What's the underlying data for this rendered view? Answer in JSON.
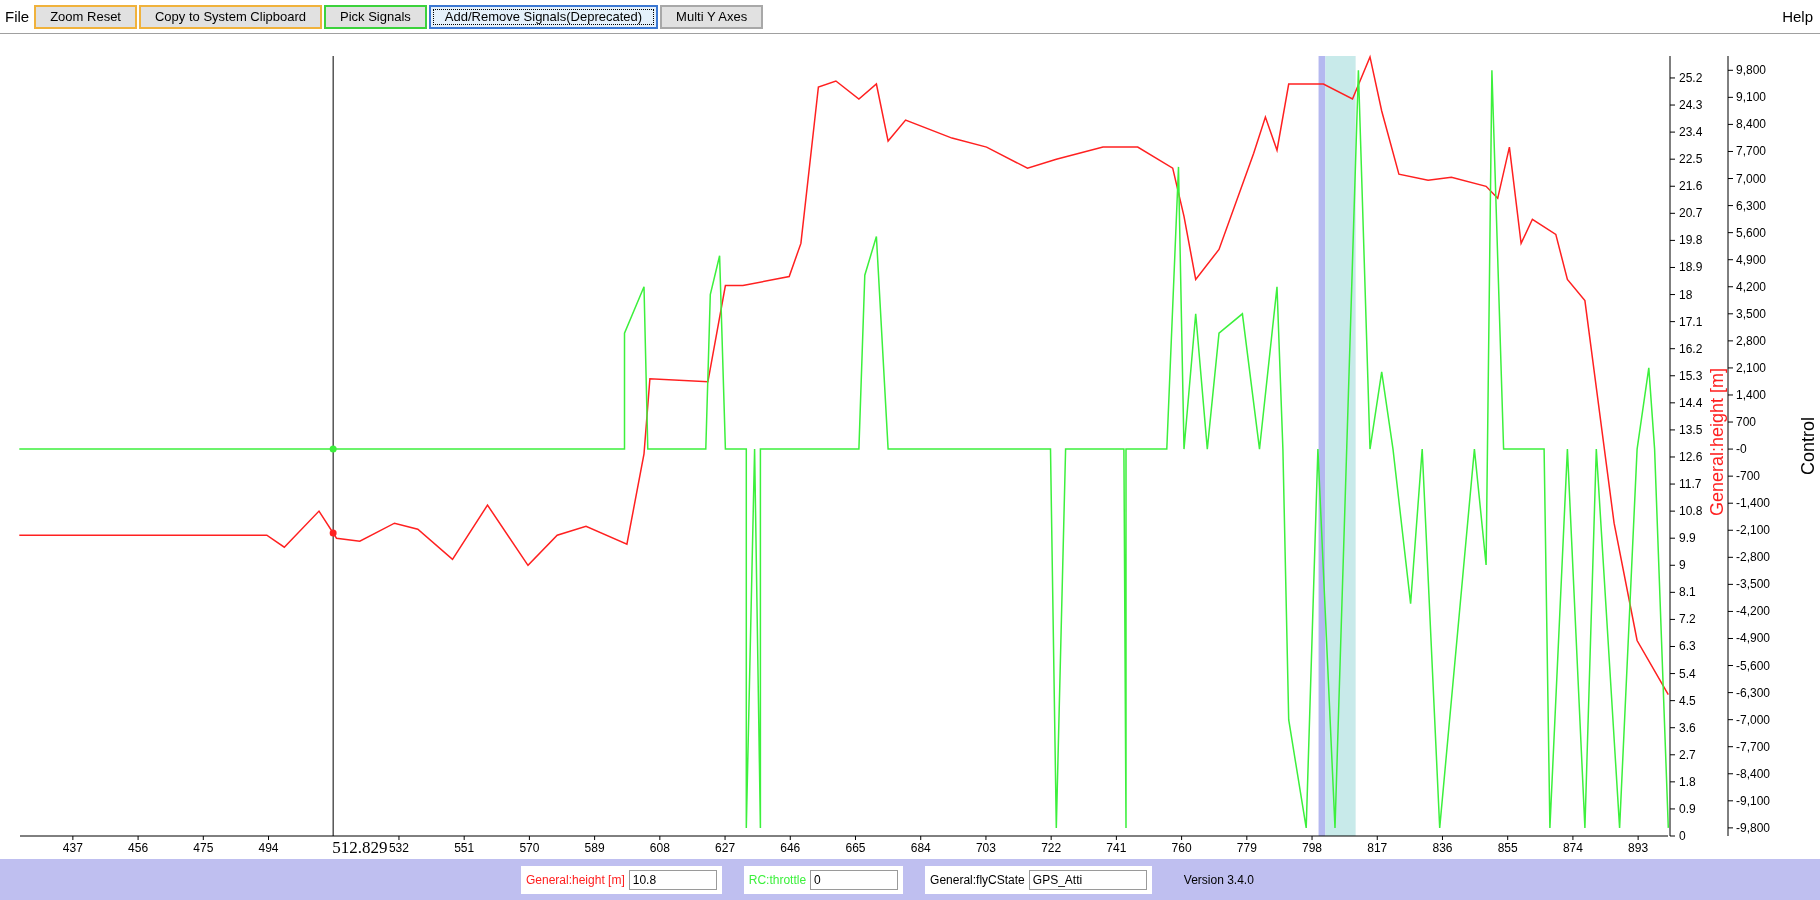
{
  "menu": {
    "file": "File",
    "help": "Help"
  },
  "toolbar": [
    {
      "label": "Zoom Reset",
      "color": "#f0b23c",
      "focused": false
    },
    {
      "label": "Copy to System Clipboard",
      "color": "#f0b23c",
      "focused": false
    },
    {
      "label": "Pick Signals",
      "color": "#3cd23c",
      "focused": false
    },
    {
      "label": "Add/Remove Signals(Deprecated)",
      "color": "#3c78d2",
      "focused": true
    },
    {
      "label": "Multi Y Axes",
      "color": "#a8a8a8",
      "focused": false
    }
  ],
  "chart_data": {
    "type": "line",
    "ylabel": "General:height [m]",
    "y2label": "Control",
    "xlim": [
      421.4,
      901.8
    ],
    "ylim": [
      0,
      25.93
    ],
    "y2lim": [
      -10010,
      10170
    ],
    "xticks": [
      437,
      456,
      475,
      494,
      532,
      551,
      570,
      589,
      608,
      627,
      646,
      665,
      684,
      703,
      722,
      741,
      760,
      779,
      798,
      817,
      836,
      855,
      874,
      893
    ],
    "yticks": [
      0,
      0.9,
      1.8,
      2.7,
      3.6,
      4.5,
      5.4,
      6.3,
      7.2,
      8.1,
      9,
      9.9,
      10.8,
      11.7,
      12.6,
      13.5,
      14.4,
      15.3,
      16.2,
      17.1,
      18,
      18.9,
      19.8,
      20.7,
      21.6,
      22.5,
      23.4,
      24.3,
      25.2
    ],
    "y2ticks": [
      {
        "value": -9800,
        "label": "-9,800"
      },
      {
        "value": -9100,
        "label": "-9,100"
      },
      {
        "value": -8400,
        "label": "-8,400"
      },
      {
        "value": -7700,
        "label": "-7,700"
      },
      {
        "value": -7000,
        "label": "-7,000"
      },
      {
        "value": -6300,
        "label": "-6,300"
      },
      {
        "value": -5600,
        "label": "-5,600"
      },
      {
        "value": -4900,
        "label": "-4,900"
      },
      {
        "value": -4200,
        "label": "-4,200"
      },
      {
        "value": -3500,
        "label": "-3,500"
      },
      {
        "value": -2800,
        "label": "-2,800"
      },
      {
        "value": -2100,
        "label": "-2,100"
      },
      {
        "value": -1400,
        "label": "-1,400"
      },
      {
        "value": -700,
        "label": "-700"
      },
      {
        "value": 0,
        "label": "-0"
      },
      {
        "value": 700,
        "label": "700"
      },
      {
        "value": 1400,
        "label": "1,400"
      },
      {
        "value": 2100,
        "label": "2,100"
      },
      {
        "value": 2800,
        "label": "2,800"
      },
      {
        "value": 3500,
        "label": "3,500"
      },
      {
        "value": 4200,
        "label": "4,200"
      },
      {
        "value": 4900,
        "label": "4,900"
      },
      {
        "value": 5600,
        "label": "5,600"
      },
      {
        "value": 6300,
        "label": "6,300"
      },
      {
        "value": 7000,
        "label": "7,000"
      },
      {
        "value": 7700,
        "label": "7,700"
      },
      {
        "value": 8400,
        "label": "8,400"
      },
      {
        "value": 9100,
        "label": "9,100"
      },
      {
        "value": 9800,
        "label": "9,800"
      }
    ],
    "series": [
      {
        "name": "General:height [m]",
        "color": "#ff2020",
        "x": [
          421.4,
          493.5,
          498.6,
          508.7,
          513.8,
          520.6,
          530.7,
          537.5,
          547.6,
          557.8,
          569.6,
          578.1,
          586.5,
          598.4,
          603.4,
          605.1,
          622.0,
          627.1,
          632.2,
          645.7,
          649.1,
          654.2,
          659.3,
          666.0,
          671.1,
          674.5,
          679.6,
          693.1,
          703.2,
          715.1,
          723.5,
          737.1,
          747.2,
          757.4,
          760.7,
          764.1,
          770.9,
          781.0,
          784.4,
          787.8,
          791.2,
          801.3,
          809.8,
          814.9,
          818.3,
          823.3,
          831.8,
          838.6,
          848.7,
          852.1,
          855.5,
          858.9,
          862.2,
          869.0,
          872.4,
          877.5,
          886.0,
          892.7,
          901.8
        ],
        "values": [
          10.0,
          10.0,
          9.6,
          10.8,
          9.9,
          9.8,
          10.4,
          10.2,
          9.2,
          11.0,
          9.0,
          10.0,
          10.3,
          9.7,
          12.7,
          15.2,
          15.1,
          18.3,
          18.3,
          18.6,
          19.7,
          24.9,
          25.1,
          24.5,
          25.0,
          23.1,
          23.8,
          23.2,
          22.9,
          22.2,
          22.5,
          22.9,
          22.9,
          22.2,
          20.6,
          18.5,
          19.5,
          22.7,
          23.9,
          22.8,
          25.0,
          25.0,
          24.5,
          25.9,
          24.1,
          22.0,
          21.8,
          21.9,
          21.6,
          21.2,
          22.9,
          19.7,
          20.5,
          20.0,
          18.5,
          17.8,
          10.4,
          6.5,
          4.7
        ]
      },
      {
        "name": "RC:throttle",
        "color": "#3cf03c",
        "axis": "y2",
        "x": [
          421.4,
          597.7,
          597.7,
          603.4,
          604.5,
          621.4,
          622.7,
          625.4,
          627.1,
          633.2,
          633.2,
          635.6,
          637.3,
          637.3,
          666.0,
          667.7,
          671.1,
          674.5,
          721.8,
          723.5,
          726.2,
          743.2,
          743.8,
          743.8,
          755.7,
          759.1,
          760.7,
          764.1,
          767.5,
          770.9,
          777.7,
          782.7,
          787.8,
          789.5,
          791.2,
          796.3,
          799.7,
          804.7,
          811.5,
          814.9,
          818.3,
          821.6,
          826.7,
          830.1,
          835.2,
          845.3,
          848.7,
          850.4,
          853.8,
          865.6,
          867.3,
          872.4,
          877.5,
          880.8,
          887.6,
          892.7,
          896.1,
          897.8,
          901.8
        ],
        "values": [
          0,
          0,
          3000,
          4200,
          0,
          0,
          4000,
          5000,
          0,
          0,
          -9800,
          0,
          -9800,
          0,
          0,
          4500,
          5500,
          0,
          0,
          -9800,
          0,
          0,
          -9800,
          0,
          0,
          7300,
          0,
          3500,
          0,
          3000,
          3500,
          0,
          4200,
          0,
          -7000,
          -9800,
          0,
          -9800,
          9800,
          0,
          2000,
          0,
          -4000,
          0,
          -9800,
          0,
          -3000,
          9800,
          0,
          0,
          -9800,
          0,
          -9800,
          0,
          -9800,
          0,
          2100,
          0,
          -9800
        ]
      }
    ],
    "ref_lines": [
      {
        "axis": "x",
        "value": 512.829,
        "label": "512.829"
      }
    ],
    "bands": [
      {
        "axis": "x",
        "from": 799.9,
        "to": 801.9,
        "color": "#b4b8f0"
      },
      {
        "axis": "x",
        "from": 801.9,
        "to": 810.7,
        "color": "#c8eaea"
      }
    ]
  },
  "status_bar": {
    "fields": [
      {
        "value": "10.8"
      },
      {
        "value": "0"
      },
      {
        "label": "General:flyCState",
        "value": "GPS_Atti"
      }
    ],
    "version": "Version 3.4.0"
  }
}
